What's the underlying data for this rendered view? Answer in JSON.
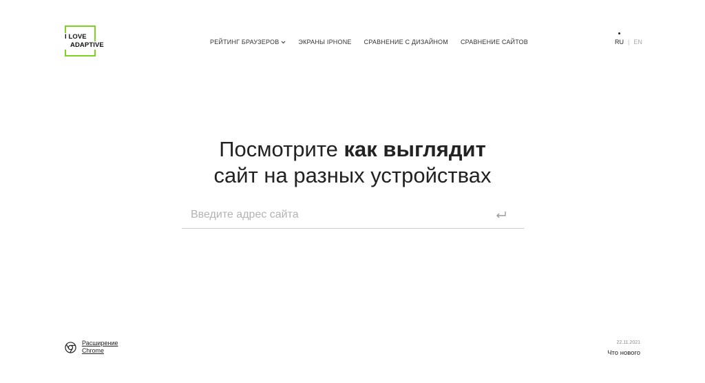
{
  "logo": {
    "line1": "I LOVE",
    "line2": "ADAPTIVE",
    "accent": "#7ed321"
  },
  "nav": {
    "items": [
      {
        "label": "РЕЙТИНГ БРАУЗЕРОВ"
      },
      {
        "label": "ЭКРАНЫ IPHONE"
      },
      {
        "label": "СРАВНЕНИЕ С ДИЗАЙНОМ"
      },
      {
        "label": "СРАВНЕНИЕ САЙТОВ"
      }
    ]
  },
  "lang": {
    "ru": "RU",
    "separator": "|",
    "en": "EN"
  },
  "hero": {
    "line1_regular": "Посмотрите ",
    "line1_bold": "как выглядит",
    "line2": "сайт на разных устройствах"
  },
  "search": {
    "placeholder": "Введите адрес сайта",
    "value": ""
  },
  "footer": {
    "extension_line1": "Расширение",
    "extension_line2": "Chrome",
    "news_date": "22.11.2021",
    "news_label": "Что нового"
  }
}
